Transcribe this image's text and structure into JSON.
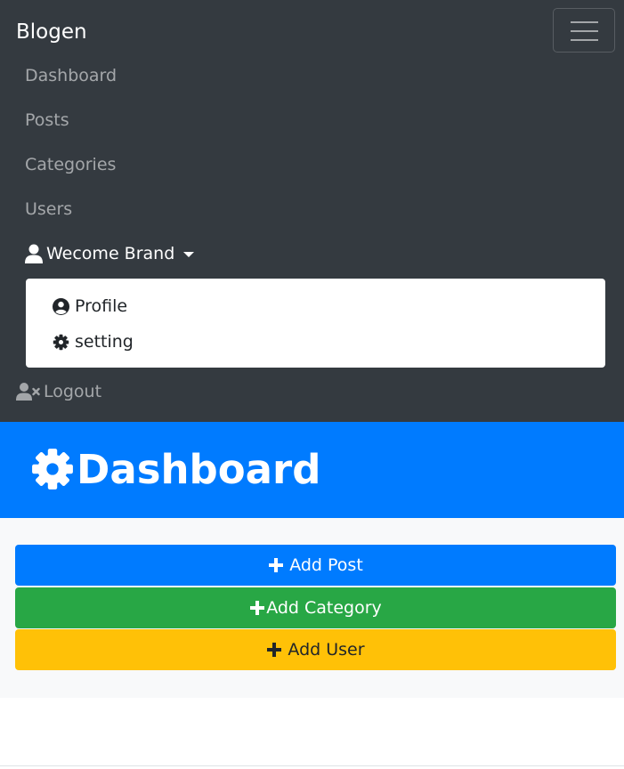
{
  "navbar": {
    "brand": "Blogen",
    "links": [
      "Dashboard",
      "Posts",
      "Categories",
      "Users"
    ],
    "user_menu_label": "Wecome Brand",
    "dropdown": {
      "profile_label": "Profile",
      "setting_label": "setting"
    },
    "logout_label": "Logout",
    "background_color": "#343a40"
  },
  "header": {
    "title": "Dashboard",
    "icon": "gear-icon",
    "background_color": "#007bff"
  },
  "actions": {
    "add_post_label": "Add Post",
    "add_category_label": "Add Category",
    "add_user_label": "Add User",
    "colors": {
      "add_post": "#007bff",
      "add_category": "#28a745",
      "add_user": "#ffc107"
    }
  }
}
